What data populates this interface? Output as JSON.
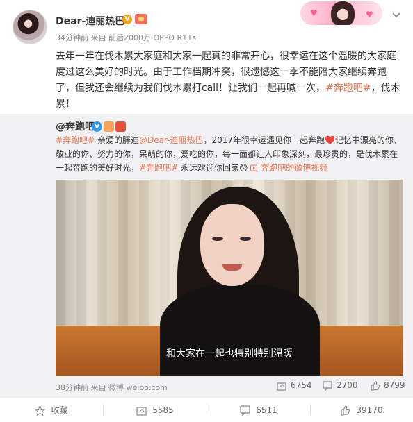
{
  "post": {
    "username": "Dear-迪丽热巴",
    "verified_badge": "V",
    "meta": "34分钟前 来自 前后2000万 OPPO R11s",
    "text_main": "去年一年在伐木累大家庭和大家一起真的非常开心，很幸运在这个温暖的大家庭度过这么美好的时光。由于工作档期冲突，很遗憾这一季不能陪大家继续奔跑了，但我还会继续为我们伐木累打call！让我们一起再喊一次，",
    "hashtag": "#奔跑吧#",
    "text_tail": "，伐木累！"
  },
  "repost": {
    "author": "@奔跑吧",
    "verified_badge": "V",
    "hashtag_start": "#奔跑吧#",
    "text_1": " 亲爱的胖迪",
    "mention": "@Dear-迪丽热巴",
    "text_2": "，2017年很幸运遇见你一起奔跑❤️记忆中漂亮的你、敬业的你、努力的你，呆萌的你，爱吃的你，每一面都让人印象深刻，最珍贵的，是伐木累在一起奔跑的美好时光，",
    "hashtag_mid": "#奔跑吧#",
    "text_3": " 永远欢迎你回家😞 ",
    "video_link": "奔跑吧的微博视频",
    "video_subtitle": "和大家在一起也特别特别温暖",
    "meta": "38分钟前 来自 微博 weibo.com",
    "stats": {
      "forward": "6754",
      "comment": "2700",
      "like": "8799"
    }
  },
  "actions": {
    "favorite": "收藏",
    "forward": "5585",
    "comment": "6511",
    "like": "39170"
  },
  "colors": {
    "link": "#eb7350",
    "repost_bg": "#f2f2f5",
    "verified": "#f8a012"
  },
  "icons": [
    "chevron-down-icon",
    "forward-icon",
    "comment-icon",
    "like-icon",
    "star-icon",
    "link-icon"
  ]
}
